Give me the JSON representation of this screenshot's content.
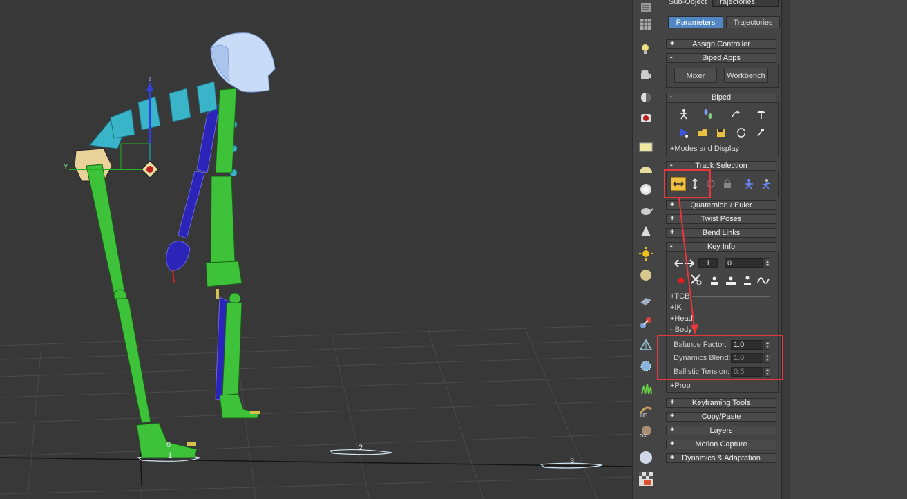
{
  "viewport": {
    "footstep_labels": [
      "0",
      "1",
      "2",
      "3"
    ],
    "gizmo_axes": {
      "z": "z",
      "y": "y"
    }
  },
  "toolbar_icons": [
    "list-icon",
    "grid-icon",
    "light-bulb-icon",
    "camera-icon",
    "sphere-half-icon",
    "render-icon",
    "rectangle-icon",
    "hemisphere-icon",
    "sphere-icon",
    "teapot-icon",
    "cone-icon",
    "sun-icon",
    "disc-icon",
    "grid-dots-icon",
    "molecule-icon",
    "pyramid-icon",
    "gear-sphere-icon",
    "grass-icon",
    "hf-icon",
    "ox-icon",
    "ball-icon",
    "checker-icon"
  ],
  "panel": {
    "sub_object_label": "Sub-Object",
    "sub_object_value": "Trajectories",
    "tabs": {
      "parameters": "Parameters",
      "trajectories": "Trajectories"
    },
    "rollouts": {
      "assign_controller": "Assign Controller",
      "biped_apps": "Biped Apps",
      "biped": "Biped",
      "track_selection": "Track Selection",
      "quaternion_euler": "Quaternion / Euler",
      "twist_poses": "Twist Poses",
      "bend_links": "Bend Links",
      "key_info": "Key Info",
      "keyframing_tools": "Keyframing Tools",
      "copy_paste": "Copy/Paste",
      "layers": "Layers",
      "motion_capture": "Motion Capture",
      "dynamics_adaptation": "Dynamics & Adaptation"
    },
    "signs": {
      "plus": "+",
      "minus": "-"
    },
    "biped_apps": {
      "mixer": "Mixer",
      "workbench": "Workbench"
    },
    "modes_and_display": "+Modes and Display",
    "key_info": {
      "key_number": "1",
      "time_value": "0",
      "sections": {
        "tcb": "+TCB",
        "ik": "+IK",
        "head": "+Head",
        "body": "- Body",
        "prop": "+Prop"
      },
      "body": {
        "balance_factor_label": "Balance Factor:",
        "balance_factor_value": "1.0",
        "dynamics_blend_label": "Dynamics Blend:",
        "dynamics_blend_value": "1.0",
        "ballistic_tension_label": "Ballistic Tension:",
        "ballistic_tension_value": "0.5"
      }
    }
  },
  "colors": {
    "annotation": "#e8383c",
    "active_tab": "#5187c4",
    "active_button": "#f0c040",
    "skeleton_green": "#3ec23a",
    "skeleton_blue": "#2a24b8",
    "spine_cyan": "#3ab4c8"
  }
}
